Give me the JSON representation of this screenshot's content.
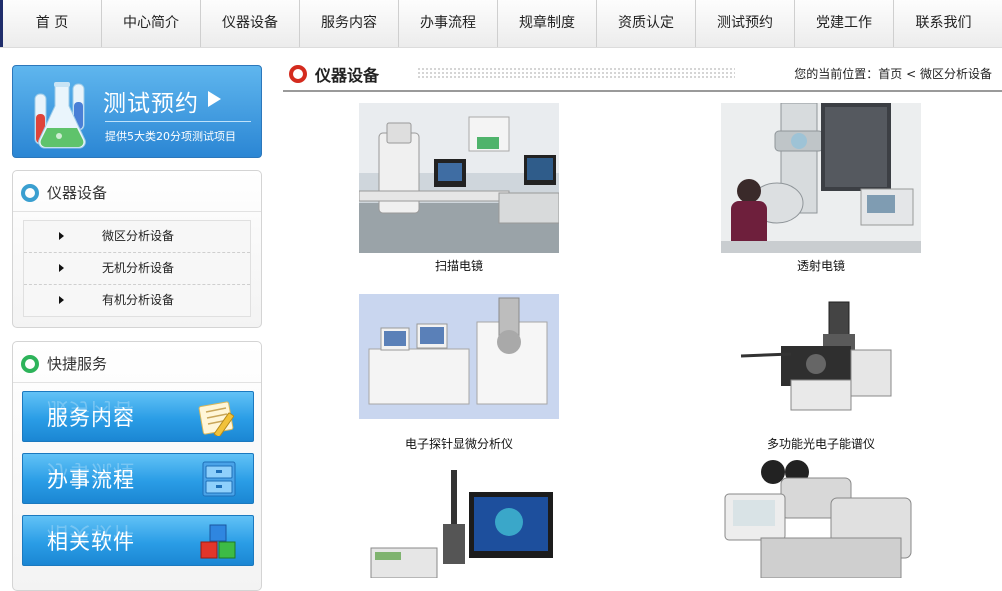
{
  "nav": [
    "首 页",
    "中心简介",
    "仪器设备",
    "服务内容",
    "办事流程",
    "规章制度",
    "资质认定",
    "测试预约",
    "党建工作",
    "联系我们"
  ],
  "promo": {
    "title": "测试预约",
    "subtitle": "提供5大类20分项测试项目"
  },
  "instrument_panel": {
    "title": "仪器设备",
    "items": [
      "微区分析设备",
      "无机分析设备",
      "有机分析设备"
    ]
  },
  "quick_panel": {
    "title": "快捷服务",
    "buttons": [
      "服务内容",
      "办事流程",
      "相关软件"
    ]
  },
  "main": {
    "title": "仪器设备",
    "breadcrumb": {
      "prefix": "您的当前位置：",
      "home": "首页",
      "sep": "<",
      "current": "微区分析设备"
    },
    "items": [
      "扫描电镜",
      "透射电镜",
      "电子探针显微分析仪",
      "多功能光电子能谱仪"
    ]
  },
  "colors": {
    "nav_edge": "#1f2d6b",
    "accent_blue": "#2b86d4",
    "red_ring": "#d42b1e",
    "green_ring": "#2db35a",
    "blue_ring": "#3a9fd0"
  }
}
